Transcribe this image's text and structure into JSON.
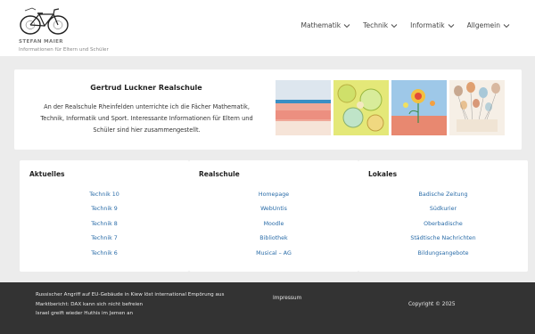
{
  "site": {
    "name": "STEFAN MAIER",
    "tagline": "Informationen für Eltern und Schüler"
  },
  "nav": [
    {
      "label": "Mathematik"
    },
    {
      "label": "Technik"
    },
    {
      "label": "Informatik"
    },
    {
      "label": "Allgemein"
    }
  ],
  "hero": {
    "title": "Gertrud Luckner Realschule",
    "text": "An der Realschule Rheinfelden unterrichte ich die Fächer Mathematik, Technik, Informatik und Sport. Interessante Informationen für Eltern und Schüler sind hier zusammengestellt."
  },
  "cards": {
    "aktuelles": {
      "title": "Aktuelles",
      "links": [
        "Technik 10",
        "Technik 9",
        "Technik 8",
        "Technik 7",
        "Technik 6"
      ]
    },
    "realschule": {
      "title": "Realschule",
      "links": [
        "Homepage",
        "WebUntis",
        "Moodle",
        "Bibliothek",
        "Musical – AG"
      ]
    },
    "lokales": {
      "title": "Lokales",
      "links": [
        "Badische Zeitung",
        "Südkurier",
        "Oberbadische",
        "Städtische Nachrichten",
        "Bildungsangebote"
      ]
    }
  },
  "footer": {
    "news": [
      "Russischer Angriff auf EU-Gebäude in Kiew löst international Empörung aus",
      "Marktbericht: DAX kann sich nicht befreien",
      "Israel greift wieder Huthis im Jemen an"
    ],
    "impressum": "Impressum",
    "copyright": "Copyright © 2025"
  },
  "colors": {
    "link": "#2a6ca8",
    "footer_bg": "#333333",
    "page_bg": "#ececec"
  }
}
